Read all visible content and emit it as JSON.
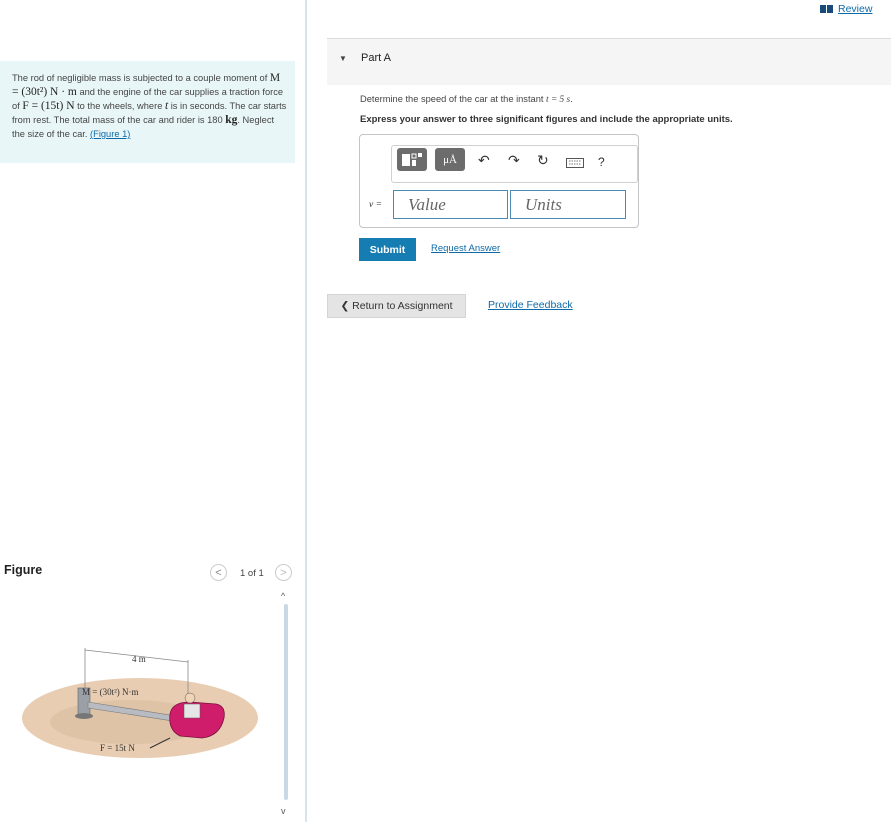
{
  "problem": {
    "p1": "The rod of negligible mass is subjected to a couple moment of ",
    "m_eq": "M = (30t²) N · m",
    "p2": " and the engine of the car supplies a traction force of ",
    "f_eq": "F = (15t) N",
    "p3": " to the wheels, where ",
    "t": "t",
    "p4": " is in seconds. The car starts from rest. The total mass of the car and rider is 180 ",
    "kg": "kg",
    "p5": ". Neglect the size of the car. ",
    "figure_link": "(Figure 1)"
  },
  "figure": {
    "title": "Figure",
    "pager_prev": "<",
    "pager_next": ">",
    "pager": "1 of 1",
    "scroll_up": "^",
    "scroll_down": "v",
    "label_length": "4 m",
    "label_moment": "M = (30t²) N·m",
    "label_force": "F = 15t N"
  },
  "header": {
    "review": "Review"
  },
  "part_a": {
    "caret": "▼",
    "title": "Part A",
    "question_prefix": "Determine the speed of the car at the instant ",
    "question_eq": "t = 5 s",
    "question_suffix": ".",
    "instruction": "Express your answer to three significant figures and include the appropriate units.",
    "toolbar": {
      "symbol": "μÅ",
      "undo": "↶",
      "redo": "↷",
      "reset": "↻",
      "help": "?"
    },
    "var_label": "v =",
    "value_placeholder": "Value",
    "units_placeholder": "Units",
    "submit": "Submit",
    "request_answer": "Request Answer"
  },
  "footer": {
    "return": "❮ Return to Assignment",
    "feedback": "Provide Feedback"
  }
}
